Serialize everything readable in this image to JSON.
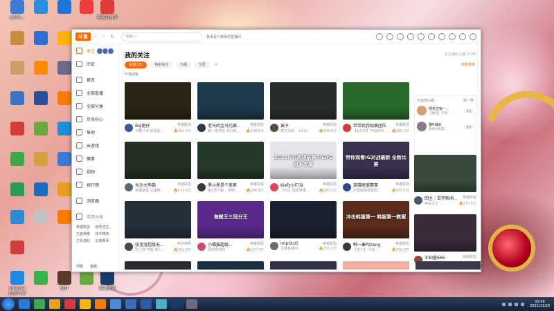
{
  "desktop": {
    "icons": [
      {
        "label": "Admi...",
        "color": "#3d7bd9"
      },
      {
        "label": "",
        "color": "#2a8ee0"
      },
      {
        "label": "",
        "color": "#1e74d8"
      },
      {
        "label": "",
        "color": "#ef3c3c"
      },
      {
        "label": "网易云音乐",
        "color": "#e03a3a"
      },
      {
        "label": "",
        "color": "#c88c3c"
      },
      {
        "label": "",
        "color": "#2d6fd1"
      },
      {
        "label": "",
        "color": "#ffb400"
      },
      {
        "label": "",
        "color": "#c9a06a"
      },
      {
        "label": "",
        "color": "#ff8a00"
      },
      {
        "label": "",
        "color": "#6a6a8a"
      },
      {
        "label": "",
        "color": "#3a74c8"
      },
      {
        "label": "",
        "color": "#2a4f9a"
      },
      {
        "label": "",
        "color": "#ff7a00"
      },
      {
        "label": "",
        "color": "#d23c3c"
      },
      {
        "label": "",
        "color": "#6aa842"
      },
      {
        "label": "",
        "color": "#1f8fd8"
      },
      {
        "label": "",
        "color": "#3aaa4a"
      },
      {
        "label": "",
        "color": "#d4a03c"
      },
      {
        "label": "",
        "color": "#3a7bd5"
      },
      {
        "label": "",
        "color": "#2a9a5a"
      },
      {
        "label": "",
        "color": "#1a6ac0"
      },
      {
        "label": "",
        "color": "#e6a020"
      },
      {
        "label": "",
        "color": "#2d8ad6"
      },
      {
        "label": "",
        "color": "#c2c2c2"
      },
      {
        "label": "",
        "color": "#ff7a00"
      },
      {
        "label": "",
        "color": "#d23c3c"
      },
      {
        "label": "Internet Explorer",
        "color": "#1e88e5"
      },
      {
        "label": "",
        "color": "#38b24a"
      },
      {
        "label": "BOT",
        "color": "#5a3a2a"
      },
      {
        "label": "",
        "color": "#6aa842"
      },
      {
        "label": "英雄联盟",
        "color": "#1a3a6a"
      }
    ]
  },
  "app": {
    "logo": "斗鱼",
    "nav": {
      "back": "‹",
      "forward": "›",
      "refresh": "↻"
    },
    "search_placeholder": "请输入...",
    "search_hint": "赛事看个赛事的直播间",
    "top_icons": [
      "history-icon",
      "heart-icon",
      "message-icon",
      "box-icon",
      "gift-icon",
      "user-icon",
      "settings-icon",
      "minimize-icon",
      "maximize-icon",
      "close-icon"
    ]
  },
  "sidebar": {
    "items": [
      {
        "label": "关注",
        "active": true
      },
      {
        "label": "历史",
        "active": false
      },
      {
        "label": "首页",
        "active": false
      },
      {
        "label": "全部直播",
        "active": false
      },
      {
        "label": "全部分类",
        "active": false
      },
      {
        "label": "贝壳中心",
        "active": false
      },
      {
        "label": "鱼吧",
        "active": false
      },
      {
        "label": "云游戏",
        "active": false
      },
      {
        "label": "赛事",
        "active": false
      },
      {
        "label": "视频",
        "active": false
      },
      {
        "label": "排行榜",
        "active": false
      },
      {
        "label": "浏览器",
        "active": false
      }
    ],
    "common_title": "常用分类",
    "common": [
      "英雄联盟",
      "绝地求生",
      "王者荣耀",
      "和平精英",
      "主机游戏",
      "云端赛事"
    ],
    "bottom": [
      "问题",
      "客服"
    ]
  },
  "content": {
    "title": "我的关注",
    "right_note": "正在播的主播 25/40",
    "filters": [
      {
        "label": "全部(25)",
        "on": true
      },
      {
        "label": "特别关注",
        "on": false
      },
      {
        "label": "分组",
        "on": false
      },
      {
        "label": "分区",
        "on": false
      }
    ],
    "filter_close": "×",
    "sort": "热度排序",
    "subnote": "开播提醒",
    "cards": [
      {
        "name": "Big肥仔",
        "cat": "英雄联盟",
        "sub": "今晚八点 最强的...",
        "heat": "462.4万",
        "thumb": "#2a2416",
        "av": "#3a5a9a",
        "banner": ""
      },
      {
        "name": "老马的金马比赛...",
        "cat": "英雄联盟",
        "sub": "第一把开始 10.28...",
        "heat": "108.6万",
        "thumb": "#1e3a4a",
        "av": "#2a3a4a",
        "banner": ""
      },
      {
        "name": "寅子",
        "cat": "英雄联盟",
        "sub": "寅子加油 ...1413",
        "heat": "309.6万",
        "thumb": "#2a2e2a",
        "av": "#5a4a3a",
        "banner": ""
      },
      {
        "name": "带带我我观赛团队",
        "cat": "英雄联盟",
        "sub": "【10/18】开始时间...",
        "heat": "285.2万",
        "thumb": "#2a6a2a",
        "av": "#d43a3a",
        "banner": ""
      },
      {
        "name": "长沙大熊猫",
        "cat": "英雄联盟",
        "sub": "英雄联盟 主播带...",
        "heat": "271.6万",
        "thumb": "#243024",
        "av": "#5a6a7a",
        "banner": ""
      },
      {
        "name": "黑小黑是个美男",
        "cat": "英雄联盟",
        "sub": "第1把下路... 带你...",
        "heat": "286.8万",
        "thumb": "#263a2a",
        "av": "#3a3a3a",
        "banner": ""
      },
      {
        "name": "Kiefy小叮当",
        "cat": "英雄联盟",
        "sub": "【PG】冠军赛事...",
        "heat": "260.1万",
        "thumb": "#e4e4ea",
        "av": "#e0445a",
        "banner": "2021IPG高级联赛 PERG冠军专属"
      },
      {
        "name": "英雄联盟赛事",
        "cat": "英雄联盟",
        "sub": "中国联赛观赛团...",
        "heat": "255.5万",
        "thumb": "#3a3050",
        "av": "#2a4a8a",
        "banner": "带你观看IG对战最新 全新比赛"
      },
      {
        "name": "张渣渣超级无...",
        "cat": "和平精英",
        "sub": "早上好 开播 加入...",
        "heat": "261.0万",
        "thumb": "#24303a",
        "av": "#4a4a4a",
        "banner": ""
      },
      {
        "name": "小橘猫超级...",
        "cat": "英雄联盟",
        "sub": "我想要你的...",
        "heat": "157.0万",
        "thumb": "#5a2a8a",
        "av": "#c84a7a",
        "banner": "海贼王三冠分王"
      },
      {
        "name": "impOUO",
        "cat": "英雄联盟",
        "sub": "主播直播中...",
        "heat": "155.2万",
        "thumb": "#1a2030",
        "av": "#6a6a6a",
        "banner": ""
      },
      {
        "name": "韩一秦Pzzang",
        "cat": "英雄联盟",
        "sub": "【主个】 今天...",
        "heat": "150.2万",
        "thumb": "#5a2a1a",
        "av": "#3a3a3a",
        "banner": "冲击韩服第一 韩服第一教案"
      }
    ],
    "col5_cards": [
      {
        "name": "回主｜玄学新闻...",
        "cat": "英雄联盟",
        "sub": "峡谷大王 ...",
        "heat": "270.5万",
        "thumb": "#3a4a3a",
        "av": "#4a5a6a"
      },
      {
        "name": "王知盛666",
        "cat": "英雄联盟",
        "sub": "峡谷观赛团 ...",
        "heat": "117.0万",
        "thumb": "#3a2a3a",
        "av": "#8a4a3a"
      }
    ],
    "rec": {
      "title": "可能感兴趣",
      "more": "换一换",
      "items": [
        {
          "name": "明天还有一...",
          "sub": "【赛后】不明...",
          "btn": "关注",
          "av": "#d4a070"
        },
        {
          "name": "猴叫最K",
          "sub": "我要你来跟...",
          "btn": "关注",
          "av": "#8a7a8a"
        }
      ]
    },
    "extra_thumbs": [
      "#2a2a30",
      "#1a3040",
      "#30304a",
      "#f2b0a0",
      "#3a3a4a"
    ]
  },
  "taskbar": {
    "buttons": [
      "#2a7ad8",
      "#3aaa4a",
      "#e8a020",
      "#d23c3c",
      "#ffb400",
      "#ff7a00",
      "#4a8ad8",
      "#3a6ab8",
      "#2a5aa8",
      "#4ab0c8",
      "#1a3a6a",
      "#6a6a7a"
    ],
    "time": "20:46",
    "date": "2021/11/20"
  }
}
